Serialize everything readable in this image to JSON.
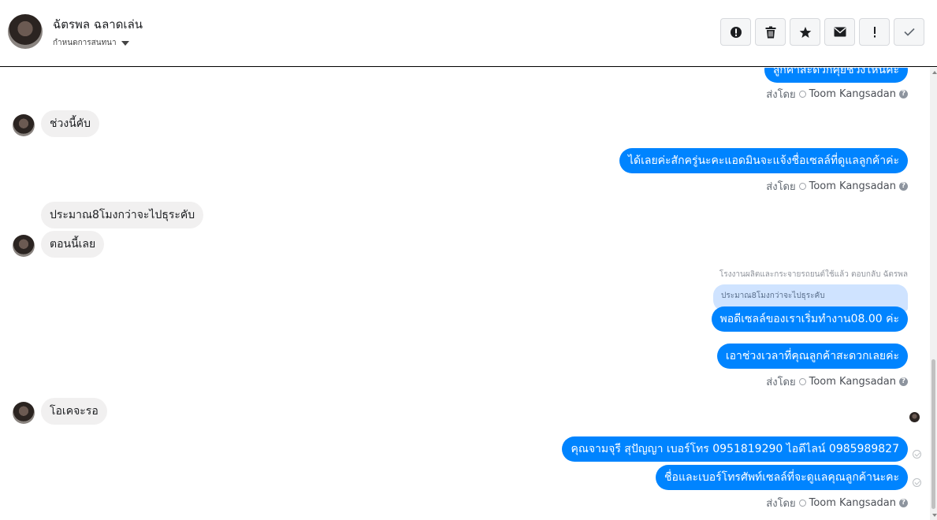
{
  "header": {
    "contact_name": "ฉัตรพล ฉลาดเล่น",
    "conversation_status": "กำหนดการสนทนา",
    "toolbar": {
      "report_icon": "exclamation-circle",
      "delete_icon": "trash",
      "star_icon": "star",
      "mark_unread_icon": "envelope",
      "important_icon": "exclamation",
      "done_icon": "check"
    }
  },
  "thread": {
    "top_cut_message": "ลูกค้าสะดวกคุยช่วงไหนคะ",
    "sent_by_label": "ส่งโดย",
    "agent_name": "Toom Kangsadan",
    "messages": {
      "in_1": "ช่วงนี้คับ",
      "out_1": "ได้เลยค่ะสักครู่นะคะแอดมินจะแจ้งชื่อเซลล์ที่ดูแลลูกค้าค่ะ",
      "in_2": "ประมาณ8โมงกว่าจะไปธุระคับ",
      "in_3": "ตอนนี้เลย",
      "reply_note": "โรงงานผลิตและกระจายรถยนต์ใช้แล้ว ตอบกลับ ฉัตรพล",
      "quoted_text": "ประมาณ8โมงกว่าจะไปธุระคับ",
      "out_2": "พอดีเซลล์ของเราเริ่มทำงาน08.00 ค่ะ",
      "out_3": "เอาช่วงเวลาที่คุณลูกค้าสะดวกเลยค่ะ",
      "in_4": "โอเคจะรอ",
      "out_4": "คุณจามจุรี สุปัญญา เบอร์โทร 0951819290  ไอดีไลน์ 0985989827",
      "out_5": "ชื่อและเบอร์โทรศัพท์เซลล์ที่จะดูแลคุณลูกค้านะคะ"
    }
  },
  "colors": {
    "outgoing_bubble": "#0084ff",
    "incoming_bubble": "#f1f0f0",
    "quoted_bubble": "#cfe3ff"
  }
}
